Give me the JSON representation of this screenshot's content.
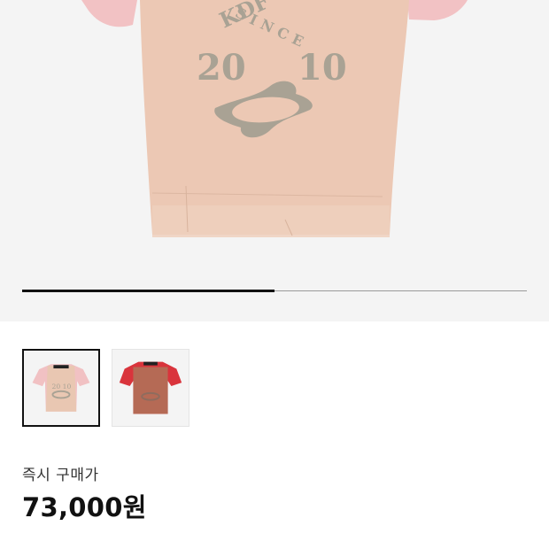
{
  "gallery": {
    "slide_progress": 0.5,
    "hero_graphic": {
      "top_text": "SINCE",
      "arc_text": "KDF",
      "year_left": "20",
      "year_right": "10"
    }
  },
  "thumbnails": [
    {
      "name": "beige-tshirt",
      "body_color": "#e9c7b2",
      "sleeve_color": "#f1c1c3",
      "selected": true
    },
    {
      "name": "red-tshirt",
      "body_color": "#b56a55",
      "sleeve_color": "#d9343c",
      "selected": false
    }
  ],
  "purchase": {
    "label": "즉시 구매가",
    "price": "73,000원"
  }
}
